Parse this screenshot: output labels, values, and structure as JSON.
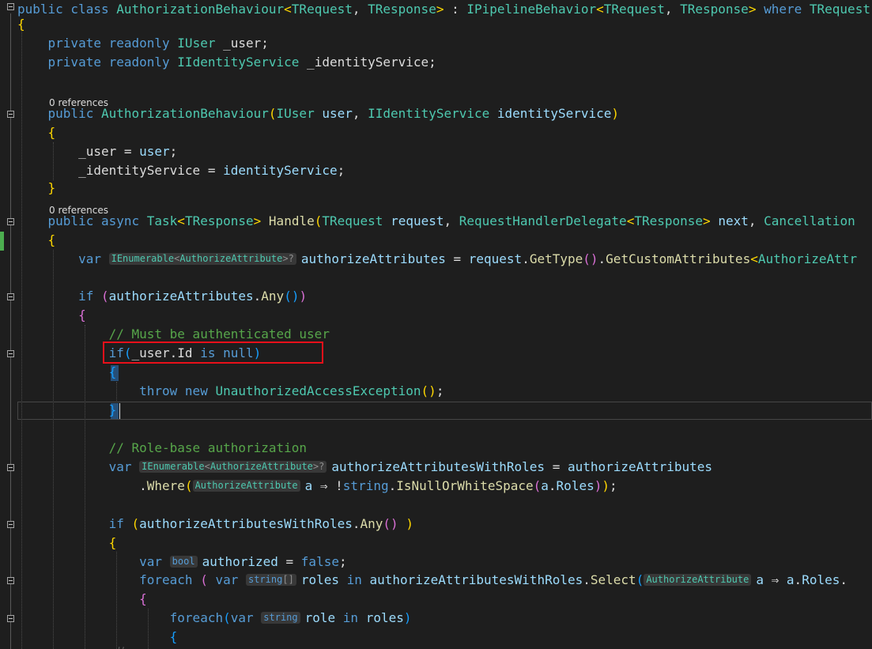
{
  "lines": [
    {
      "small": false,
      "tokens": [
        {
          "t": "kw",
          "v": "public class "
        },
        {
          "t": "ty",
          "v": "AuthorizationBehaviour"
        },
        {
          "t": "br",
          "v": "<"
        },
        {
          "t": "ty",
          "v": "TRequest"
        },
        {
          "t": "pl",
          "v": ", "
        },
        {
          "t": "ty",
          "v": "TResponse"
        },
        {
          "t": "br",
          "v": ">"
        },
        {
          "t": "pl",
          "v": " : "
        },
        {
          "t": "ty",
          "v": "IPipelineBehavior"
        },
        {
          "t": "br",
          "v": "<"
        },
        {
          "t": "ty",
          "v": "TRequest"
        },
        {
          "t": "pl",
          "v": ", "
        },
        {
          "t": "ty",
          "v": "TResponse"
        },
        {
          "t": "br",
          "v": ">"
        },
        {
          "t": "kw",
          "v": " where "
        },
        {
          "t": "ty",
          "v": "TRequest"
        }
      ]
    },
    {
      "small": false,
      "tokens": [
        {
          "t": "br",
          "v": "{"
        }
      ]
    },
    {
      "small": false,
      "tokens": [
        {
          "t": "pl",
          "v": "    "
        },
        {
          "t": "kw",
          "v": "private readonly "
        },
        {
          "t": "ty",
          "v": "IUser"
        },
        {
          "t": "pl",
          "v": " _user;"
        }
      ]
    },
    {
      "small": false,
      "tokens": [
        {
          "t": "pl",
          "v": "    "
        },
        {
          "t": "kw",
          "v": "private readonly "
        },
        {
          "t": "ty",
          "v": "IIdentityService"
        },
        {
          "t": "pl",
          "v": " _identityService;"
        }
      ]
    },
    {
      "small": false,
      "tokens": []
    },
    {
      "small": true,
      "tokens": [
        {
          "t": "pl",
          "v": "0 references"
        }
      ]
    },
    {
      "small": false,
      "tokens": [
        {
          "t": "pl",
          "v": "    "
        },
        {
          "t": "kw",
          "v": "public "
        },
        {
          "t": "ty",
          "v": "AuthorizationBehaviour"
        },
        {
          "t": "br",
          "v": "("
        },
        {
          "t": "ty",
          "v": "IUser"
        },
        {
          "t": "pl",
          "v": " "
        },
        {
          "t": "id",
          "v": "user"
        },
        {
          "t": "pl",
          "v": ", "
        },
        {
          "t": "ty",
          "v": "IIdentityService"
        },
        {
          "t": "pl",
          "v": " "
        },
        {
          "t": "id",
          "v": "identityService"
        },
        {
          "t": "br",
          "v": ")"
        }
      ]
    },
    {
      "small": false,
      "tokens": [
        {
          "t": "pl",
          "v": "    "
        },
        {
          "t": "br",
          "v": "{"
        }
      ]
    },
    {
      "small": false,
      "tokens": [
        {
          "t": "pl",
          "v": "        _user = "
        },
        {
          "t": "id",
          "v": "user"
        },
        {
          "t": "pl",
          "v": ";"
        }
      ]
    },
    {
      "small": false,
      "tokens": [
        {
          "t": "pl",
          "v": "        _identityService = "
        },
        {
          "t": "id",
          "v": "identityService"
        },
        {
          "t": "pl",
          "v": ";"
        }
      ]
    },
    {
      "small": false,
      "tokens": [
        {
          "t": "pl",
          "v": "    "
        },
        {
          "t": "br",
          "v": "}"
        }
      ]
    },
    {
      "small": true,
      "tokens": [
        {
          "t": "pl",
          "v": "0 references"
        }
      ]
    },
    {
      "small": false,
      "tokens": [
        {
          "t": "pl",
          "v": "    "
        },
        {
          "t": "kw",
          "v": "public async "
        },
        {
          "t": "ty",
          "v": "Task"
        },
        {
          "t": "br",
          "v": "<"
        },
        {
          "t": "ty",
          "v": "TResponse"
        },
        {
          "t": "br",
          "v": ">"
        },
        {
          "t": "pl",
          "v": " "
        },
        {
          "t": "mt",
          "v": "Handle"
        },
        {
          "t": "br",
          "v": "("
        },
        {
          "t": "ty",
          "v": "TRequest"
        },
        {
          "t": "pl",
          "v": " "
        },
        {
          "t": "id",
          "v": "request"
        },
        {
          "t": "pl",
          "v": ", "
        },
        {
          "t": "ty",
          "v": "RequestHandlerDelegate"
        },
        {
          "t": "br",
          "v": "<"
        },
        {
          "t": "ty",
          "v": "TResponse"
        },
        {
          "t": "br",
          "v": ">"
        },
        {
          "t": "pl",
          "v": " "
        },
        {
          "t": "id",
          "v": "next"
        },
        {
          "t": "pl",
          "v": ", "
        },
        {
          "t": "ty",
          "v": "Cancellation"
        }
      ]
    },
    {
      "small": false,
      "tokens": [
        {
          "t": "pl",
          "v": "    "
        },
        {
          "t": "br",
          "v": "{"
        }
      ]
    },
    {
      "small": false,
      "tokens": [
        {
          "t": "pl",
          "v": "        "
        },
        {
          "t": "kw",
          "v": "var "
        },
        {
          "t": "hint",
          "parts": [
            {
              "c": "ty",
              "v": "IEnumerable"
            },
            {
              "c": "pl",
              "v": "<"
            },
            {
              "c": "ty",
              "v": "AuthorizeAttribute"
            },
            {
              "c": "pl",
              "v": ">?"
            }
          ]
        },
        {
          "t": "id",
          "v": "authorizeAttributes"
        },
        {
          "t": "pl",
          "v": " = "
        },
        {
          "t": "id",
          "v": "request"
        },
        {
          "t": "pl",
          "v": "."
        },
        {
          "t": "mt",
          "v": "GetType"
        },
        {
          "t": "bp",
          "v": "()"
        },
        {
          "t": "pl",
          "v": "."
        },
        {
          "t": "mt",
          "v": "GetCustomAttributes"
        },
        {
          "t": "br",
          "v": "<"
        },
        {
          "t": "ty",
          "v": "AuthorizeAttr"
        }
      ]
    },
    {
      "small": false,
      "tokens": []
    },
    {
      "small": false,
      "tokens": [
        {
          "t": "pl",
          "v": "        "
        },
        {
          "t": "kw",
          "v": "if "
        },
        {
          "t": "bp",
          "v": "("
        },
        {
          "t": "id",
          "v": "authorizeAttributes"
        },
        {
          "t": "pl",
          "v": "."
        },
        {
          "t": "mt",
          "v": "Any"
        },
        {
          "t": "bb",
          "v": "()"
        },
        {
          "t": "bp",
          "v": ")"
        }
      ]
    },
    {
      "small": false,
      "tokens": [
        {
          "t": "pl",
          "v": "        "
        },
        {
          "t": "bp",
          "v": "{"
        }
      ]
    },
    {
      "small": false,
      "tokens": [
        {
          "t": "pl",
          "v": "            "
        },
        {
          "t": "cm",
          "v": "// Must be authenticated user"
        }
      ]
    },
    {
      "small": false,
      "tokens": [
        {
          "t": "pl",
          "v": "            "
        },
        {
          "t": "kw",
          "v": "if"
        },
        {
          "t": "bb",
          "v": "("
        },
        {
          "t": "pl",
          "v": "_user.Id "
        },
        {
          "t": "kw",
          "v": "is null"
        },
        {
          "t": "bb",
          "v": ")"
        }
      ]
    },
    {
      "small": false,
      "tokens": [
        {
          "t": "pl",
          "v": "            "
        },
        {
          "t": "bb",
          "v": "{"
        }
      ]
    },
    {
      "small": false,
      "tokens": [
        {
          "t": "pl",
          "v": "                "
        },
        {
          "t": "kw",
          "v": "throw new "
        },
        {
          "t": "ty",
          "v": "UnauthorizedAccessException"
        },
        {
          "t": "br",
          "v": "()"
        },
        {
          "t": "pl",
          "v": ";"
        }
      ]
    },
    {
      "small": false,
      "tokens": [
        {
          "t": "pl",
          "v": "            "
        },
        {
          "t": "bb",
          "v": "}"
        }
      ]
    },
    {
      "small": false,
      "tokens": []
    },
    {
      "small": false,
      "tokens": [
        {
          "t": "pl",
          "v": "            "
        },
        {
          "t": "cm",
          "v": "// Role-base authorization"
        }
      ]
    },
    {
      "small": false,
      "tokens": [
        {
          "t": "pl",
          "v": "            "
        },
        {
          "t": "kw",
          "v": "var "
        },
        {
          "t": "hint",
          "parts": [
            {
              "c": "ty",
              "v": "IEnumerable"
            },
            {
              "c": "pl",
              "v": "<"
            },
            {
              "c": "ty",
              "v": "AuthorizeAttribute"
            },
            {
              "c": "pl",
              "v": ">?"
            }
          ]
        },
        {
          "t": "id",
          "v": "authorizeAttributesWithRoles"
        },
        {
          "t": "pl",
          "v": " = "
        },
        {
          "t": "id",
          "v": "authorizeAttributes"
        }
      ]
    },
    {
      "small": false,
      "tokens": [
        {
          "t": "pl",
          "v": "                ."
        },
        {
          "t": "mt",
          "v": "Where"
        },
        {
          "t": "br",
          "v": "("
        },
        {
          "t": "hint",
          "parts": [
            {
              "c": "ty",
              "v": "AuthorizeAttribute"
            }
          ]
        },
        {
          "t": "id",
          "v": "a"
        },
        {
          "t": "pl",
          "v": " ⇒ !"
        },
        {
          "t": "kw",
          "v": "string"
        },
        {
          "t": "pl",
          "v": "."
        },
        {
          "t": "mt",
          "v": "IsNullOrWhiteSpace"
        },
        {
          "t": "bp",
          "v": "("
        },
        {
          "t": "id",
          "v": "a"
        },
        {
          "t": "pl",
          "v": "."
        },
        {
          "t": "id",
          "v": "Roles"
        },
        {
          "t": "bp",
          "v": ")"
        },
        {
          "t": "br",
          "v": ")"
        },
        {
          "t": "pl",
          "v": ";"
        }
      ]
    },
    {
      "small": false,
      "tokens": []
    },
    {
      "small": false,
      "tokens": [
        {
          "t": "pl",
          "v": "            "
        },
        {
          "t": "kw",
          "v": "if "
        },
        {
          "t": "br",
          "v": "("
        },
        {
          "t": "id",
          "v": "authorizeAttributesWithRoles"
        },
        {
          "t": "pl",
          "v": "."
        },
        {
          "t": "mt",
          "v": "Any"
        },
        {
          "t": "bp",
          "v": "()"
        },
        {
          "t": "pl",
          "v": " "
        },
        {
          "t": "br",
          "v": ")"
        }
      ]
    },
    {
      "small": false,
      "tokens": [
        {
          "t": "pl",
          "v": "            "
        },
        {
          "t": "br",
          "v": "{"
        }
      ]
    },
    {
      "small": false,
      "tokens": [
        {
          "t": "pl",
          "v": "                "
        },
        {
          "t": "kw",
          "v": "var "
        },
        {
          "t": "hint",
          "parts": [
            {
              "c": "kw",
              "v": "bool"
            }
          ]
        },
        {
          "t": "id",
          "v": "authorized"
        },
        {
          "t": "pl",
          "v": " = "
        },
        {
          "t": "kw",
          "v": "false"
        },
        {
          "t": "pl",
          "v": ";"
        }
      ]
    },
    {
      "small": false,
      "tokens": [
        {
          "t": "pl",
          "v": "                "
        },
        {
          "t": "kw",
          "v": "foreach "
        },
        {
          "t": "bp",
          "v": "("
        },
        {
          "t": "pl",
          "v": " "
        },
        {
          "t": "kw",
          "v": "var "
        },
        {
          "t": "hint",
          "parts": [
            {
              "c": "kw",
              "v": "string"
            },
            {
              "c": "pl",
              "v": "[]"
            }
          ]
        },
        {
          "t": "id",
          "v": "roles"
        },
        {
          "t": "kw",
          "v": " in "
        },
        {
          "t": "id",
          "v": "authorizeAttributesWithRoles"
        },
        {
          "t": "pl",
          "v": "."
        },
        {
          "t": "mt",
          "v": "Select"
        },
        {
          "t": "bb",
          "v": "("
        },
        {
          "t": "hint",
          "parts": [
            {
              "c": "ty",
              "v": "AuthorizeAttribute"
            }
          ]
        },
        {
          "t": "id",
          "v": "a"
        },
        {
          "t": "pl",
          "v": " ⇒ "
        },
        {
          "t": "id",
          "v": "a"
        },
        {
          "t": "pl",
          "v": "."
        },
        {
          "t": "id",
          "v": "Roles"
        },
        {
          "t": "pl",
          "v": "."
        }
      ]
    },
    {
      "small": false,
      "tokens": [
        {
          "t": "pl",
          "v": "                "
        },
        {
          "t": "bp",
          "v": "{"
        }
      ]
    },
    {
      "small": false,
      "tokens": [
        {
          "t": "pl",
          "v": "                    "
        },
        {
          "t": "kw",
          "v": "foreach"
        },
        {
          "t": "bb",
          "v": "("
        },
        {
          "t": "kw",
          "v": "var "
        },
        {
          "t": "hint",
          "parts": [
            {
              "c": "kw",
              "v": "string"
            }
          ]
        },
        {
          "t": "id",
          "v": "role"
        },
        {
          "t": "kw",
          "v": " in "
        },
        {
          "t": "id",
          "v": "roles"
        },
        {
          "t": "bb",
          "v": ")"
        }
      ]
    },
    {
      "small": false,
      "tokens": [
        {
          "t": "pl",
          "v": "                    "
        },
        {
          "t": "bb",
          "v": "{"
        }
      ]
    }
  ],
  "colors": {
    "background": "#1e1e1e",
    "keyword": "#569cd6",
    "type": "#4ec9b0",
    "identifier": "#9cdcfe",
    "comment": "#57a64a",
    "method": "#dcdcaa",
    "highlight_box": "#e8101a",
    "change_bar": "#4cae4f"
  }
}
